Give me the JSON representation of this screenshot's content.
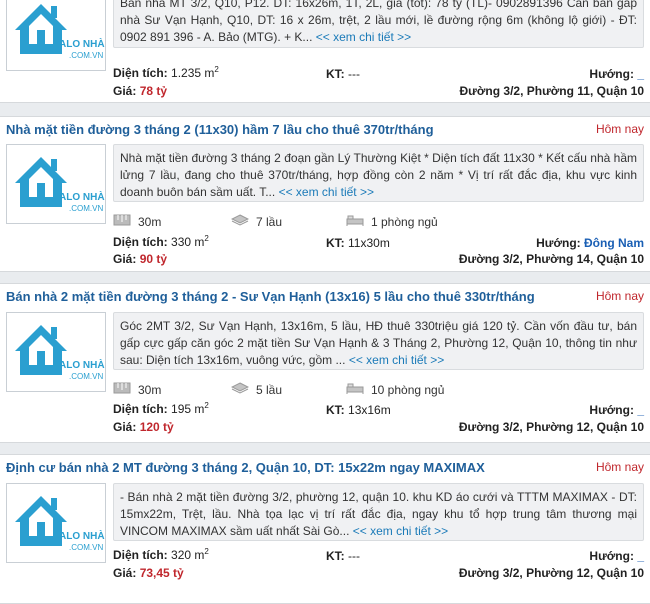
{
  "listings": [
    {
      "title": "",
      "date": "",
      "description": "Bán nhà MT 3/2, Q10, P12. DT: 16x26m, 1T, 2L, giá (tốt): 78 tỷ (TL)- 0902891396 Cần bán gấp nhà Sư Vạn Hạnh, Q10, DT: 16 x 26m, trệt, 2 lầu mới, lề đường rộng 6m (không lộ giới) - ĐT: 0902 891 396 - A. Bảo (MTG). + K...",
      "more_label": "<< xem chi tiết >>",
      "area_label": "Diện tích:",
      "area_value": "1.235 m",
      "area_sup": "2",
      "kt_label": "KT:",
      "kt_value": "---",
      "price_label": "Giá:",
      "price_value": "78 tỷ",
      "direction_label": "Hướng:",
      "direction_value": "_",
      "address": "Đường 3/2, Phường 11, Quận 10"
    },
    {
      "title": "Nhà mặt tiền đường 3 tháng 2 (11x30) hầm 7 lầu cho thuê 370tr/tháng",
      "date": "Hôm nay",
      "description": "Nhà mặt tiền đường 3 tháng 2 đoạn gần Lý Thường Kiệt * Diện tích đất 11x30 * Kết cấu nhà hầm lửng 7 lầu, đang cho thuê 370tr/tháng, hợp đồng còn 2 năm * Vị trí rất đắc địa, khu vực kinh doanh buôn bán sầm uất. T...",
      "more_label": "<< xem chi tiết >>",
      "frontage": "30m",
      "floors": "7 lầu",
      "bedrooms": "1 phòng ngủ",
      "area_label": "Diện tích:",
      "area_value": "330 m",
      "area_sup": "2",
      "kt_label": "KT:",
      "kt_value": "11x30m",
      "price_label": "Giá:",
      "price_value": "90 tỷ",
      "direction_label": "Hướng:",
      "direction_value": "Đông Nam",
      "address": "Đường 3/2, Phường 14, Quận 10"
    },
    {
      "title": "Bán nhà 2 mặt tiền đường 3 tháng 2 - Sư Vạn Hạnh (13x16) 5 lầu cho thuê 330tr/tháng",
      "date": "Hôm nay",
      "description": "Góc 2MT 3/2, Sư Vạn Hạnh, 13x16m, 5 lầu, HĐ thuê 330triệu giá 120 tỷ. Cần vốn đầu tư, bán gấp cực gấp căn góc 2 mặt tiền Sư Vạn Hạnh & 3 Tháng 2, Phường 12, Quận 10, thông tin như sau: Diện tích 13x16m, vuông vức, gồm ...",
      "more_label": "<< xem chi tiết >>",
      "frontage": "30m",
      "floors": "5 lầu",
      "bedrooms": "10 phòng ngủ",
      "area_label": "Diện tích:",
      "area_value": "195 m",
      "area_sup": "2",
      "kt_label": "KT:",
      "kt_value": "13x16m",
      "price_label": "Giá:",
      "price_value": "120 tỷ",
      "direction_label": "Hướng:",
      "direction_value": "_",
      "address": "Đường 3/2, Phường 12, Quận 10"
    },
    {
      "title": "Định cư bán nhà 2 MT đường 3 tháng 2, Quận 10, DT: 15x22m ngay MAXIMAX",
      "date": "Hôm nay",
      "description": "- Bán nhà 2 mặt tiền đường 3/2, phường 12, quận 10. khu KD áo cưới và TTTM MAXIMAX - DT: 15mx22m, Trệt, lầu. Nhà tọa lạc vị trí rất đắc địa, ngay khu tổ hợp trung tâm thương mại VINCOM MAXIMAX sầm uất nhất Sài Gò...",
      "more_label": "<< xem chi tiết >>",
      "area_label": "Diện tích:",
      "area_value": "320 m",
      "area_sup": "2",
      "kt_label": "KT:",
      "kt_value": "---",
      "price_label": "Giá:",
      "price_value": "73,45 tỷ",
      "direction_label": "Hướng:",
      "direction_value": "_",
      "address": "Đường 3/2, Phường 12, Quận 10"
    }
  ],
  "logo": {
    "line1": "ALO NHÀ ĐẤT",
    "line2": ".COM.VN"
  },
  "colors": {
    "title": "#1f5f9a",
    "price": "#c0272d",
    "logo": "#2a9fd0",
    "link": "#1a7ab8"
  }
}
